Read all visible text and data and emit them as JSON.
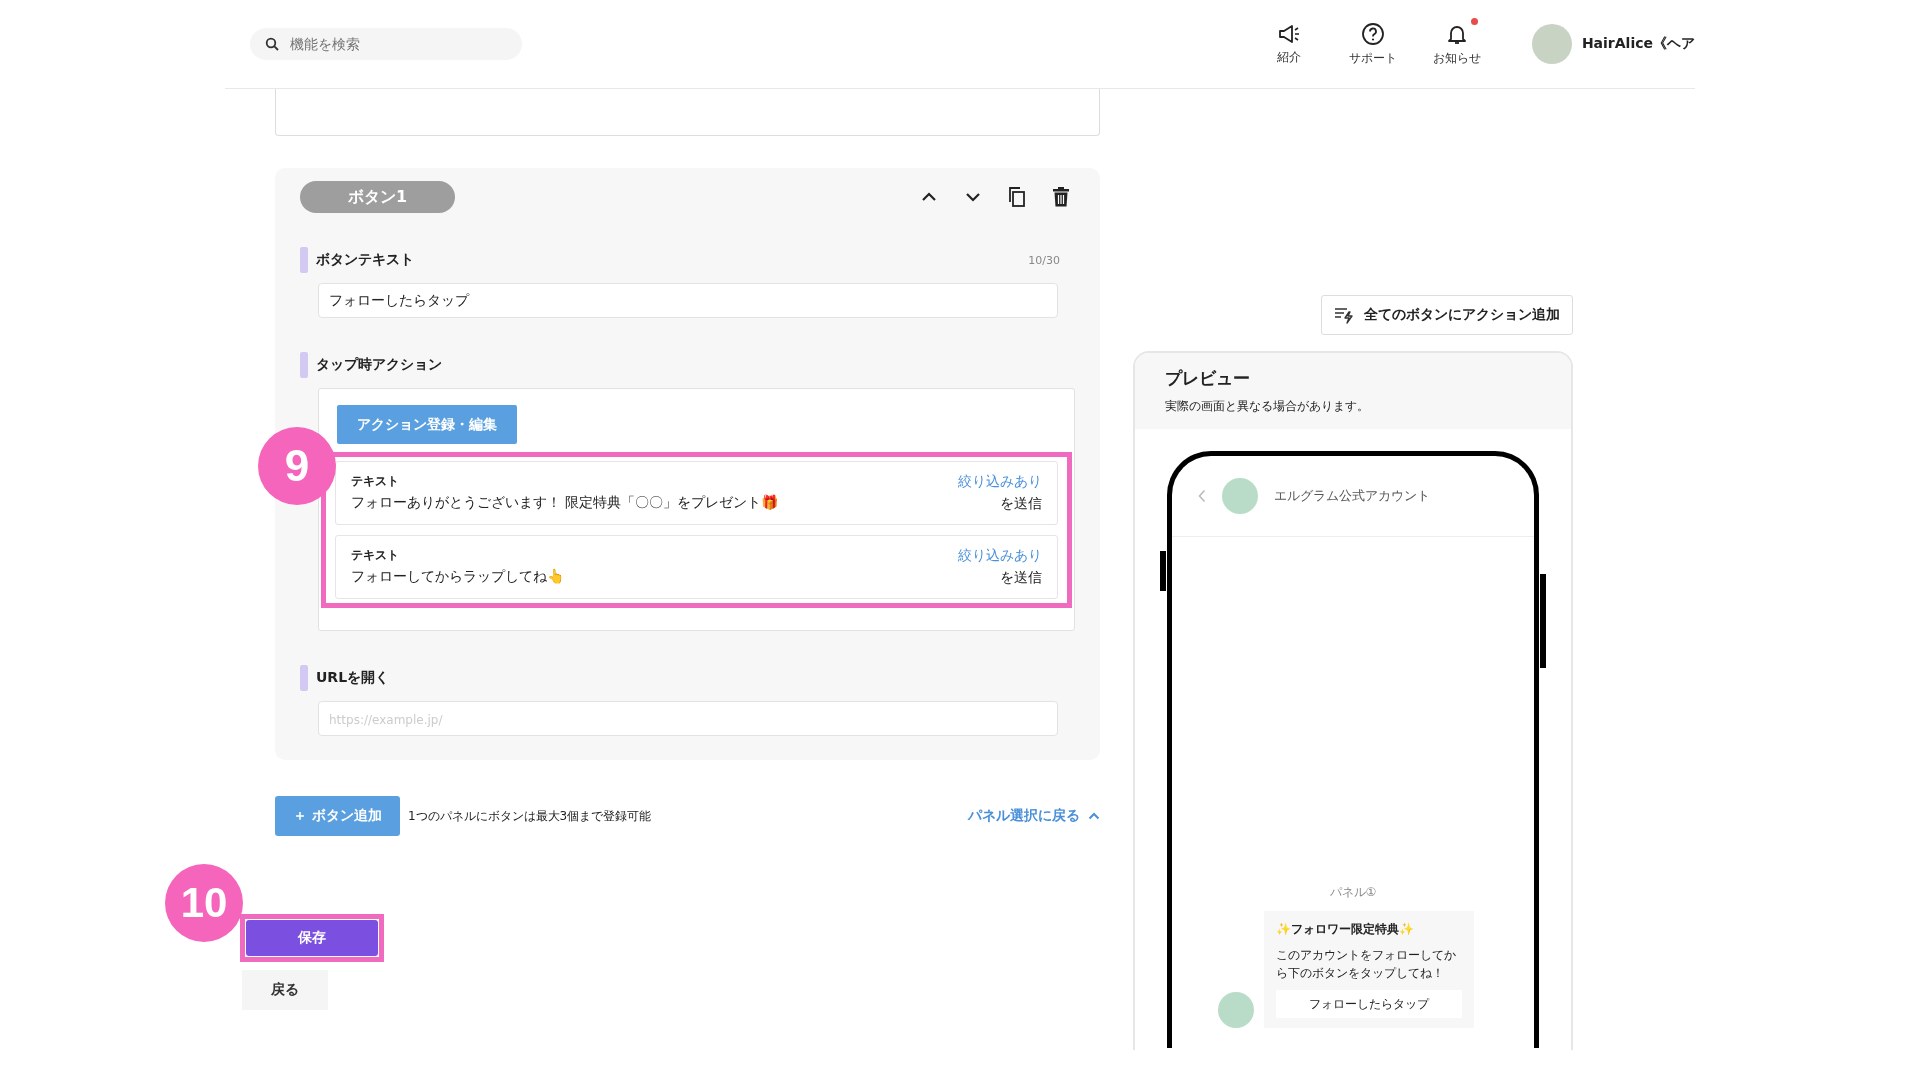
{
  "header": {
    "search": {
      "placeholder": "機能を検索"
    },
    "icons": [
      {
        "kind": "megaphone",
        "label": "紹介",
        "badge": false
      },
      {
        "kind": "help",
        "label": "サポート",
        "badge": false
      },
      {
        "kind": "bell",
        "label": "お知らせ",
        "badge": true
      }
    ],
    "user": {
      "name": "HairAlice《ヘア"
    }
  },
  "editor": {
    "tag": "ボタン1",
    "tools": [
      {
        "kind": "up"
      },
      {
        "kind": "down"
      },
      {
        "kind": "copy"
      },
      {
        "kind": "delete"
      }
    ],
    "button_text": {
      "label": "ボタンテキスト",
      "counter": "10/30",
      "value": "フォローしたらタップ"
    },
    "tap_action": {
      "label": "タップ時アクション",
      "edit_button": "アクション登録・編集",
      "actions": [
        {
          "type": "テキスト",
          "text": "フォローありがとうございます！ 限定特典「〇〇」をプレゼント🎁",
          "filter": "絞り込みあり",
          "suffix": "を送信"
        },
        {
          "type": "テキスト",
          "text": "フォローしてからラップしてね👆",
          "filter": "絞り込みあり",
          "suffix": "を送信"
        }
      ]
    },
    "url": {
      "label": "URLを開く",
      "placeholder": "https://example.jp/"
    },
    "add_button": "＋ ボタン追加",
    "note": "1つのパネルにボタンは最大3個まで登録可能",
    "back_to_panel": "パネル選択に戻る"
  },
  "save": "保存",
  "back": "戻る",
  "annotations": [
    {
      "number": "9"
    },
    {
      "number": "10"
    }
  ],
  "preview": {
    "bulk_button": "全てのボタンにアクション追加",
    "title": "プレビュー",
    "note": "実際の画面と異なる場合があります。",
    "account": "エルグラム公式アカウント",
    "panel_label": "パネル①",
    "message": {
      "title": "✨フォロワー限定特典✨",
      "body": "このアカウントをフォローしてから下のボタンをタップしてね！",
      "button": "フォローしたらタップ"
    }
  }
}
